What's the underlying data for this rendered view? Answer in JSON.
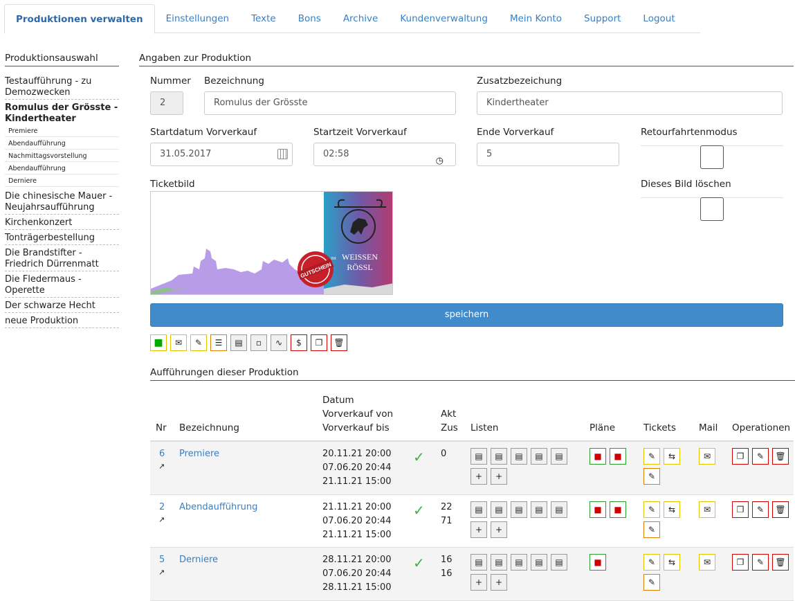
{
  "tabs": [
    "Produktionen verwalten",
    "Einstellungen",
    "Texte",
    "Bons",
    "Archive",
    "Kundenverwaltung",
    "Mein Konto",
    "Support",
    "Logout"
  ],
  "sidebar": {
    "title": "Produktionsauswahl",
    "items": [
      {
        "label": "Testaufführung - zu Demozwecken"
      },
      {
        "label": "Romulus der Grösste - Kindertheater",
        "active": true,
        "subs": [
          "Premiere",
          "Abendaufführung",
          "Nachmittagsvorstellung",
          "Abendaufführung",
          "Derniere"
        ]
      },
      {
        "label": "Die chinesische Mauer - Neujahrsaufführung"
      },
      {
        "label": "Kirchenkonzert"
      },
      {
        "label": "Tonträgerbestellung"
      },
      {
        "label": "Die Brandstifter - Friedrich Dürrenmatt"
      },
      {
        "label": "Die Fledermaus - Operette"
      },
      {
        "label": "Der schwarze Hecht"
      },
      {
        "label": "neue Produktion"
      }
    ]
  },
  "form": {
    "section_title": "Angaben zur Produktion",
    "nummer_label": "Nummer",
    "nummer_value": "2",
    "bezeichnung_label": "Bezeichnung",
    "bezeichnung_value": "Romulus der Grösste",
    "zusatz_label": "Zusatzbezeichung",
    "zusatz_value": "Kindertheater",
    "startdatum_label": "Startdatum Vorverkauf",
    "startdatum_value": "31.05.2017",
    "startzeit_label": "Startzeit Vorverkauf",
    "startzeit_value": "02:58",
    "ende_label": "Ende Vorverkauf",
    "ende_value": "5",
    "retour_label": "Retourfahrtenmodus",
    "ticketbild_label": "Ticketbild",
    "bild_loeschen_label": "Dieses Bild löschen",
    "ticket_image_text": {
      "im": "IM",
      "brand1": "WEISSEN",
      "brand2": "RÖSSL",
      "stamp": "GUTSCHEIN"
    },
    "save_label": "speichern"
  },
  "performances": {
    "title": "Aufführungen dieser Produktion",
    "headers": {
      "nr": "Nr",
      "bezeichnung": "Bezeichnung",
      "datum": "Datum",
      "vvk_von": "Vorverkauf von",
      "vvk_bis": "Vorverkauf bis",
      "akt": "Akt",
      "zus": "Zus",
      "listen": "Listen",
      "plaene": "Pläne",
      "tickets": "Tickets",
      "mail": "Mail",
      "operationen": "Operationen"
    },
    "rows": [
      {
        "nr": "6",
        "name": "Premiere",
        "datum": "20.11.21 20:00",
        "von": "07.06.20 20:44",
        "bis": "21.11.21 15:00",
        "akt": "0",
        "zus": ""
      },
      {
        "nr": "2",
        "name": "Abendaufführung",
        "datum": "21.11.21 20:00",
        "von": "07.06.20 20:44",
        "bis": "21.11.21 15:00",
        "akt": "22",
        "zus": "71"
      },
      {
        "nr": "5",
        "name": "Derniere",
        "datum": "28.11.21 20:00",
        "von": "07.06.20 20:44",
        "bis": "28.11.21 15:00",
        "akt": "16",
        "zus": "16"
      }
    ]
  }
}
